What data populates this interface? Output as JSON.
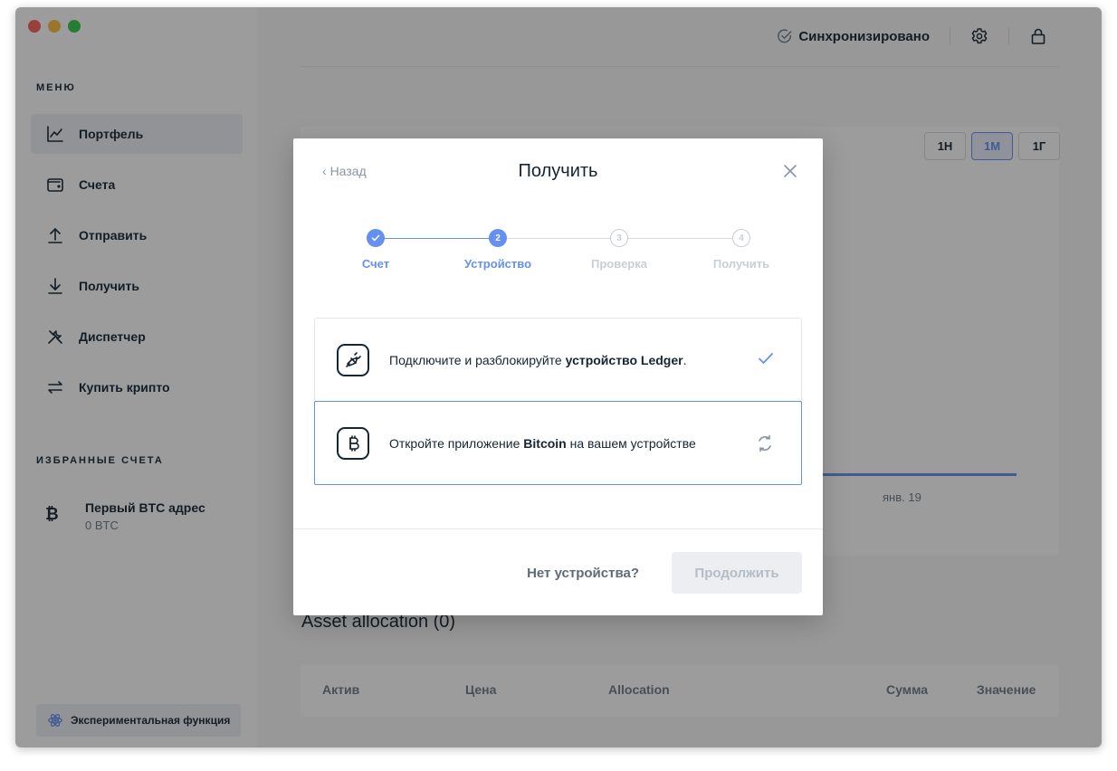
{
  "sidebar": {
    "menu_title": "МЕНЮ",
    "items": [
      {
        "label": "Портфель",
        "icon": "chart-icon",
        "active": true
      },
      {
        "label": "Счета",
        "icon": "wallet-icon",
        "active": false
      },
      {
        "label": "Отправить",
        "icon": "upload-icon",
        "active": false
      },
      {
        "label": "Получить",
        "icon": "download-icon",
        "active": false
      },
      {
        "label": "Диспетчер",
        "icon": "tools-icon",
        "active": false
      },
      {
        "label": "Купить крипто",
        "icon": "exchange-icon",
        "active": false
      }
    ],
    "favorites_title": "ИЗБРАННЫЕ СЧЕТА",
    "favorite": {
      "name": "Первый BTC адрес",
      "balance": "0 BTC",
      "icon": "bitcoin-icon"
    },
    "experimental_label": "Экспериментальная функция"
  },
  "topbar": {
    "sync_label": "Синхронизировано"
  },
  "main": {
    "range_buttons": [
      {
        "label": "1Н",
        "active": false
      },
      {
        "label": "1М",
        "active": true
      },
      {
        "label": "1Г",
        "active": false
      }
    ],
    "chart_tick": "янв. 19",
    "allocation_title": "Asset allocation (0)",
    "table_columns": [
      "Актив",
      "Цена",
      "Allocation",
      "Сумма",
      "Значение"
    ]
  },
  "modal": {
    "back_label": "Назад",
    "title": "Получить",
    "steps": [
      {
        "label": "Счет",
        "number": "1",
        "state": "done"
      },
      {
        "label": "Устройство",
        "number": "2",
        "state": "active"
      },
      {
        "label": "Проверка",
        "number": "3",
        "state": "todo"
      },
      {
        "label": "Получить",
        "number": "4",
        "state": "todo"
      }
    ],
    "row1": {
      "prefix": "Подключите и разблокируйте ",
      "bold": "устройство Ledger",
      "suffix": "."
    },
    "row2": {
      "prefix": "Откройте приложение ",
      "bold": "Bitcoin",
      "suffix": " на вашем устройстве"
    },
    "no_device_label": "Нет устройства?",
    "continue_label": "Продолжить"
  },
  "colors": {
    "accent": "#6490f1",
    "text": "#142533",
    "muted": "#6f7b88",
    "overlay": "rgba(20,20,20,0.42)"
  }
}
